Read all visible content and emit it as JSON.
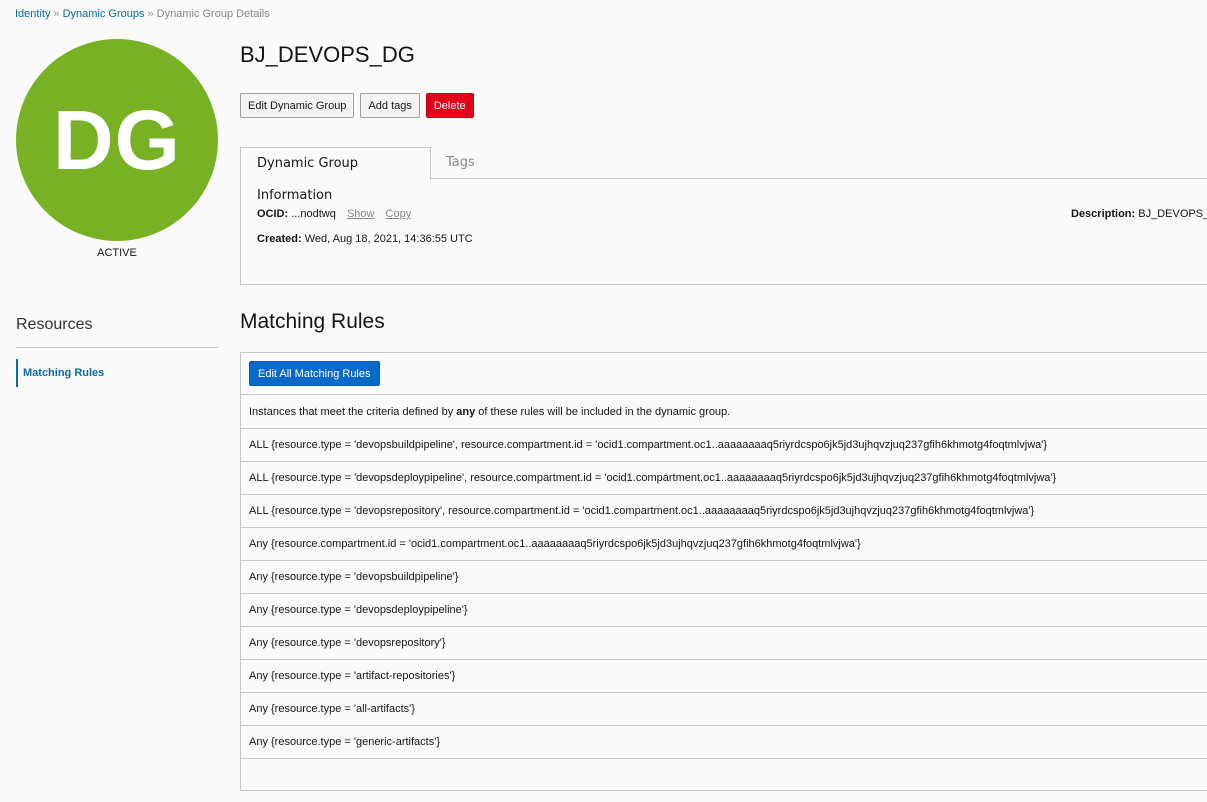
{
  "breadcrumb": {
    "items": [
      "Identity",
      "Dynamic Groups"
    ],
    "separator": "»",
    "current": "Dynamic Group Details"
  },
  "avatar": {
    "initials": "DG",
    "color": "#78b224"
  },
  "status": "ACTIVE",
  "resources": {
    "title": "Resources",
    "items": [
      "Matching Rules"
    ]
  },
  "header": {
    "title": "BJ_DEVOPS_DG",
    "buttons": {
      "edit": "Edit Dynamic Group",
      "tags": "Add tags",
      "delete": "Delete"
    }
  },
  "tabs": {
    "info": "Dynamic Group Information",
    "tags": "Tags"
  },
  "info": {
    "ocid_label": "OCID:",
    "ocid_value": "...nodtwq",
    "show": "Show",
    "copy": "Copy",
    "created_label": "Created:",
    "created_value": "Wed, Aug 18, 2021, 14:36:55 UTC",
    "description_label": "Description:",
    "description_value": "BJ_DEVOPS_"
  },
  "matching_rules": {
    "title": "Matching Rules",
    "edit_button": "Edit All Matching Rules",
    "intro_before": "Instances that meet the criteria defined by ",
    "intro_bold": "any",
    "intro_after": " of these rules will be included in the dynamic group.",
    "rules": [
      "ALL {resource.type = 'devopsbuildpipeline', resource.compartment.id = 'ocid1.compartment.oc1..aaaaaaaaq5riyrdcspo6jk5jd3ujhqvzjuq237gfih6khmotg4foqtmlvjwa'}",
      "ALL {resource.type = 'devopsdeploypipeline', resource.compartment.id = 'ocid1.compartment.oc1..aaaaaaaaq5riyrdcspo6jk5jd3ujhqvzjuq237gfih6khmotg4foqtmlvjwa'}",
      "ALL {resource.type = 'devopsrepository', resource.compartment.id = 'ocid1.compartment.oc1..aaaaaaaaq5riyrdcspo6jk5jd3ujhqvzjuq237gfih6khmotg4foqtmlvjwa'}",
      "Any {resource.compartment.id = 'ocid1.compartment.oc1..aaaaaaaaq5riyrdcspo6jk5jd3ujhqvzjuq237gfih6khmotg4foqtmlvjwa'}",
      "Any {resource.type = 'devopsbuildpipeline'}",
      "Any {resource.type = 'devopsdeploypipeline'}",
      "Any {resource.type = 'devopsrepository'}",
      "Any {resource.type = 'artifact-repositories'}",
      "Any {resource.type = 'all-artifacts'}",
      "Any {resource.type = 'generic-artifacts'}"
    ]
  }
}
